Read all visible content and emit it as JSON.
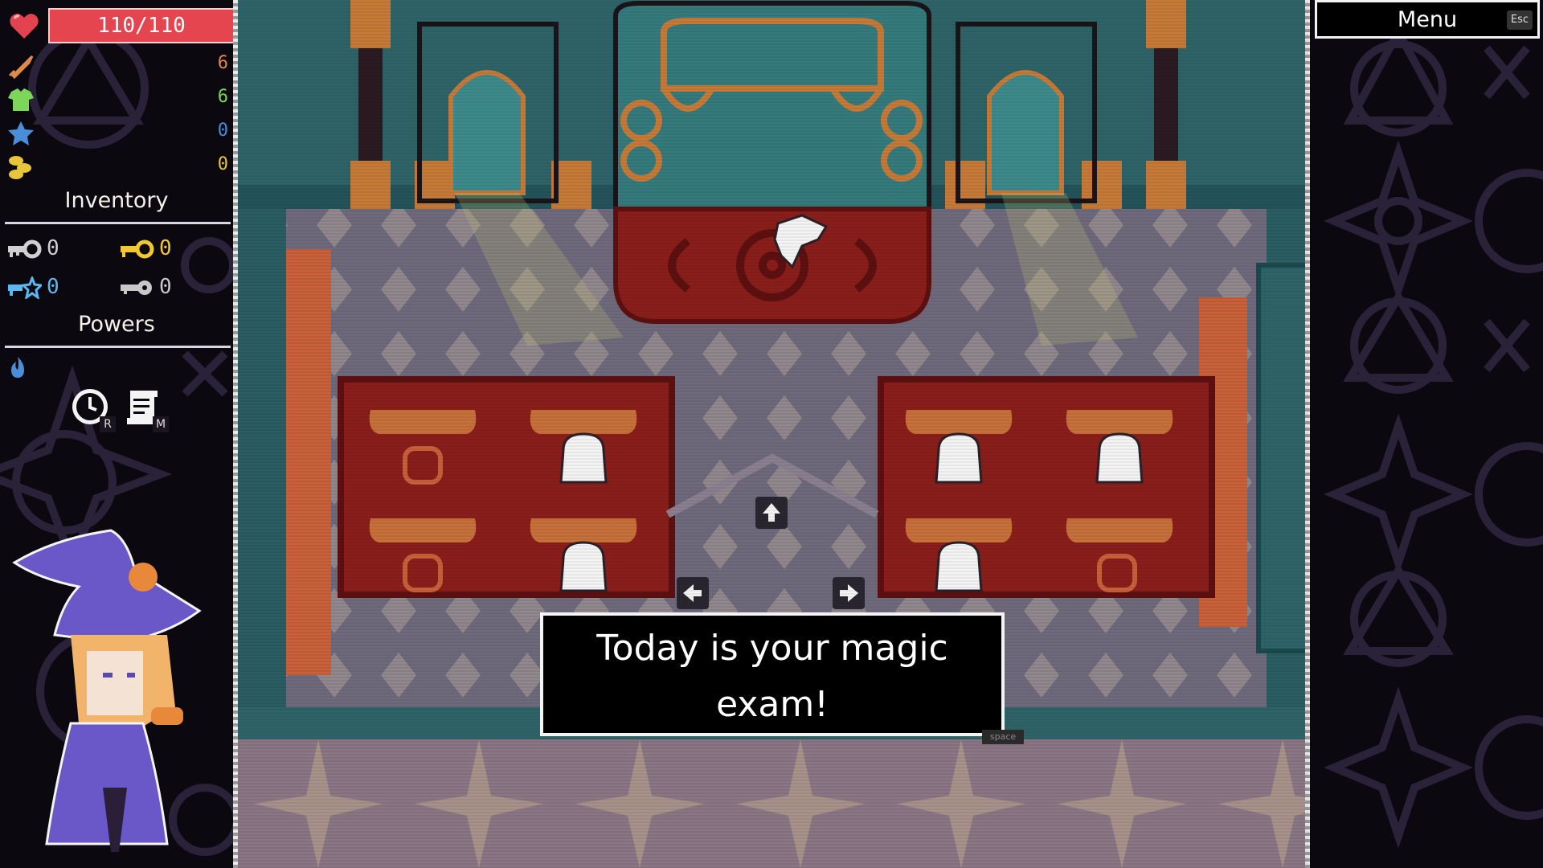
{
  "hud": {
    "hp": "110/110",
    "stats": [
      {
        "name": "attack",
        "icon": "sword-icon",
        "value": "6",
        "color": "#e08a4a"
      },
      {
        "name": "defense",
        "icon": "shirt-icon",
        "value": "6",
        "color": "#7bd65a"
      },
      {
        "name": "magic",
        "icon": "star-icon",
        "value": "0",
        "color": "#4a8ed8"
      },
      {
        "name": "gold",
        "icon": "coins-icon",
        "value": "0",
        "color": "#e8c63a"
      }
    ],
    "inventory_title": "Inventory",
    "keys": [
      {
        "icon": "silver-key-icon",
        "count": "0",
        "color": "#d0d0d0"
      },
      {
        "icon": "gold-key-icon",
        "count": "0",
        "color": "#f2c832"
      },
      {
        "icon": "blue-star-key-icon",
        "count": "0",
        "color": "#5bb8f0"
      },
      {
        "icon": "grey-key-icon",
        "count": "0",
        "color": "#c8c8c8"
      }
    ],
    "powers_title": "Powers",
    "powers": [
      {
        "icon": "clock-icon",
        "key": "R"
      },
      {
        "icon": "scroll-icon",
        "key": "M"
      }
    ]
  },
  "dialog": {
    "line1": "Today is your magic",
    "line2": "exam!",
    "hint": "space"
  },
  "menu": {
    "label": "Menu",
    "esc": "Esc"
  }
}
